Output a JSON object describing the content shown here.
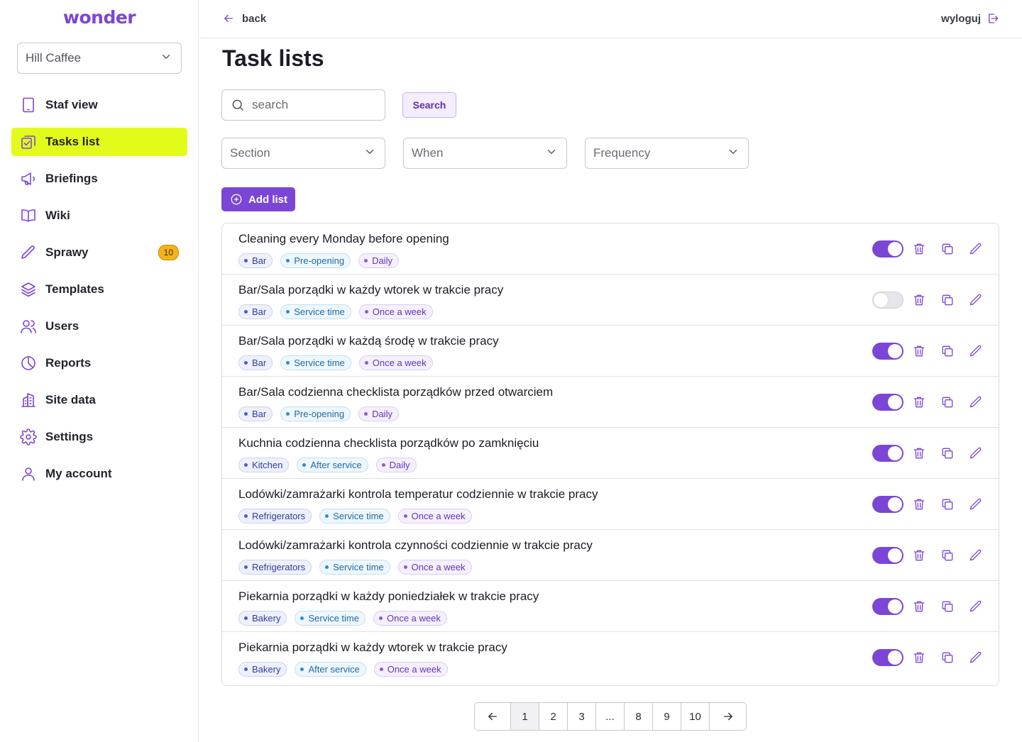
{
  "app": {
    "logo": "wonder"
  },
  "site_select": {
    "value": "Hill Caffee"
  },
  "sidebar": {
    "items": [
      {
        "label": "Staf view",
        "icon": "tablet-icon",
        "active": false
      },
      {
        "label": "Tasks list",
        "icon": "tasks-icon",
        "active": true
      },
      {
        "label": "Briefings",
        "icon": "megaphone-icon",
        "active": false
      },
      {
        "label": "Wiki",
        "icon": "book-icon",
        "active": false
      },
      {
        "label": "Sprawy",
        "icon": "pencil-icon",
        "active": false,
        "badge": "10"
      },
      {
        "label": "Templates",
        "icon": "layers-icon",
        "active": false
      },
      {
        "label": "Users",
        "icon": "users-icon",
        "active": false
      },
      {
        "label": "Reports",
        "icon": "pie-chart-icon",
        "active": false
      },
      {
        "label": "Site data",
        "icon": "building-icon",
        "active": false
      },
      {
        "label": "Settings",
        "icon": "gear-icon",
        "active": false
      },
      {
        "label": "My account",
        "icon": "user-icon",
        "active": false
      }
    ]
  },
  "topbar": {
    "back_label": "back",
    "logout_label": "wyloguj"
  },
  "main": {
    "title": "Task lists",
    "search": {
      "placeholder": "search",
      "value": "",
      "button_label": "Search"
    },
    "filters": {
      "section": "Section",
      "when": "When",
      "frequency": "Frequency"
    },
    "add_label": "Add list"
  },
  "task_lists": [
    {
      "title": "Cleaning every Monday before opening",
      "section": "Bar",
      "when": "Pre-opening",
      "frequency": "Daily",
      "enabled": true
    },
    {
      "title": "Bar/Sala porządki w każdy wtorek w trakcie pracy",
      "section": "Bar",
      "when": "Service time",
      "frequency": "Once a week",
      "enabled": false
    },
    {
      "title": "Bar/Sala porządki w każdą środę w trakcie pracy",
      "section": "Bar",
      "when": "Service time",
      "frequency": "Once a week",
      "enabled": true
    },
    {
      "title": "Bar/Sala codzienna checklista porządków przed otwarciem",
      "section": "Bar",
      "when": "Pre-opening",
      "frequency": "Daily",
      "enabled": true
    },
    {
      "title": "Kuchnia codzienna checklista porządków po zamknięciu",
      "section": "Kitchen",
      "when": "After service",
      "frequency": "Daily",
      "enabled": true
    },
    {
      "title": "Lodówki/zamrażarki kontrola temperatur codziennie w trakcie pracy",
      "section": "Refrigerators",
      "when": "Service time",
      "frequency": "Once a week",
      "enabled": true
    },
    {
      "title": "Lodówki/zamrażarki kontrola czynności codziennie w trakcie pracy",
      "section": "Refrigerators",
      "when": "Service time",
      "frequency": "Once a week",
      "enabled": true
    },
    {
      "title": "Piekarnia porządki w każdy poniedziałek w trakcie pracy",
      "section": "Bakery",
      "when": "Service time",
      "frequency": "Once a week",
      "enabled": true
    },
    {
      "title": "Piekarnia porządki w każdy wtorek w trakcie pracy",
      "section": "Bakery",
      "when": "After service",
      "frequency": "Once a week",
      "enabled": true
    }
  ],
  "pagination": {
    "pages": [
      "1",
      "2",
      "3",
      "...",
      "8",
      "9",
      "10"
    ],
    "current": "1"
  },
  "colors": {
    "accent": "#7b46d6",
    "active_nav": "#e2fb1b",
    "badge": "#f3b41b"
  }
}
